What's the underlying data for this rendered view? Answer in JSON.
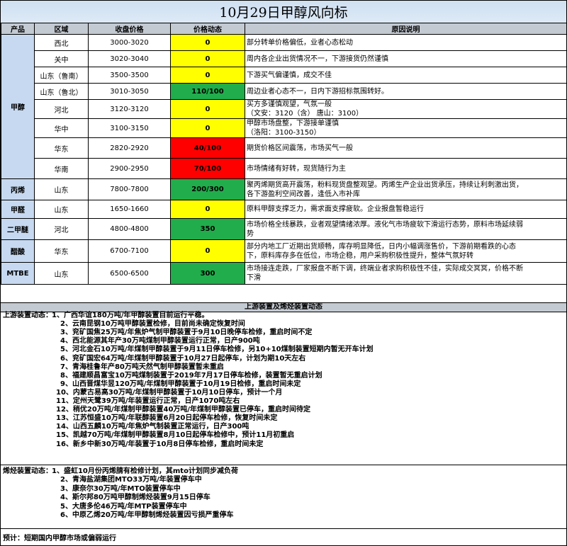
{
  "title": "10月29日甲醇风向标",
  "headers": [
    "产品",
    "区域",
    "收盘价格",
    "价格动态",
    "原因说明"
  ],
  "rows": [
    {
      "product": "甲醇",
      "region": "西北",
      "price": "3000-3020",
      "change": "0",
      "color": "yellow",
      "reason": [
        "部分转单价格偏低，业者心态松动"
      ]
    },
    {
      "product": "",
      "region": "关中",
      "price": "3020-3040",
      "change": "0",
      "color": "yellow",
      "reason": [
        "周内各企业出货情况不一，下游接货仍然谨慎"
      ]
    },
    {
      "product": "",
      "region": "山东（鲁南）",
      "price": "3500-3500",
      "change": "0",
      "color": "yellow",
      "reason": [
        "下游买气偏谨慎，成交不佳"
      ]
    },
    {
      "product": "",
      "region": "山东（鲁北）",
      "price": "3010-3050",
      "change": "110/100",
      "color": "green",
      "reason": [
        "周边业者心态不一，日内下游招标氛围转好。"
      ]
    },
    {
      "product": "",
      "region": "河北",
      "price": "3120-3120",
      "change": "0",
      "color": "yellow",
      "reason": [
        "买方多谨慎观望，气氛一般",
        "（文安：3120（含） 唐山：3100）"
      ]
    },
    {
      "product": "",
      "region": "华中",
      "price": "3100-3150",
      "change": "0",
      "color": "yellow",
      "reason": [
        "甲醇市场盘整，下游接单谨慎",
        "（洛阳：3100-3150）"
      ]
    },
    {
      "product": "",
      "region": "华东",
      "price": "2820-2920",
      "change": "40/100",
      "color": "red",
      "reason": [
        "期货价格区间震荡，市场买气一般"
      ]
    },
    {
      "product": "",
      "region": "华南",
      "price": "2900-2950",
      "change": "70/100",
      "color": "red",
      "reason": [
        "市场情绪有好转，现货随行为主"
      ]
    },
    {
      "product": "丙烯",
      "region": "山东",
      "price": "7800-7800",
      "change": "200/300",
      "color": "green",
      "reason": [
        "聚丙烯期货高开震荡，粉料现货盘整观望。丙烯生产企业出货承压，持续让利刺激出货，",
        "各下游盈利空间改善，逢低入市补库"
      ]
    },
    {
      "product": "甲醛",
      "region": "山东",
      "price": "1650-1660",
      "change": "0",
      "color": "yellow",
      "reason": [
        "原料甲醇支撑乏力，需求面支撑疲软。企业报盘暂稳运行"
      ]
    },
    {
      "product": "二甲醚",
      "region": "河北",
      "price": "4800-4800",
      "change": "350",
      "color": "green",
      "reason": [
        "市场价格全线暴跌，业者观望情绪浓厚。液化气市场疲软下滑运行态势，原料市场延续弱",
        "势"
      ]
    },
    {
      "product": "醋酸",
      "region": "华东",
      "price": "6700-7100",
      "change": "0",
      "color": "yellow",
      "reason": [
        "部分内地工厂近期出货顺畅，库存明显降低，日内小幅调涨售价，下游前期看跌的心态",
        "下，原料库存多在低位，市场企稳，用户采购积极性提升，整体气氛好转"
      ]
    },
    {
      "product": "MTBE",
      "region": "山东",
      "price": "6500-6500",
      "change": "300",
      "color": "green",
      "reason": [
        "市场接连走跌，厂家报盘不断下调，终端业者求购积极性不佳，实际成交冥冥，价格不断",
        "下滑"
      ]
    }
  ],
  "section_title": "上游装置及烯烃装置动态",
  "upstream": {
    "label": "上游装置动态：",
    "items": [
      "1、广西华谊180万吨/年甲醇装置目前运行平稳。",
      "2、云南昆钢10万吨甲醇装置检修，目前尚未确定恢复时间",
      "3、兖矿国焦25万吨/年焦炉气制甲醇装置于9月10日晚停车检修，重启时间不定",
      "4、西北能源其年产30万吨煤制甲醇装置运行正常，日产900吨",
      "5、河北金石10万吨/年煤制甲醇装置于9月11日停车检修，另10+10煤制装置短期内暂无开车计划",
      "6、兖矿国宏64万吨/年煤制甲醇装置于10月27日起停车，计划为期10天左右",
      "7、青海桂鲁年产80万吨天然气制甲醇装置暂未重启",
      "8、福建顺昌富宝10万吨煤制装置于2019年7月17日停车检修，装置暂无重启计划",
      "9、山西晋煤华昱120万吨/年煤制甲醇装置于10月19日检修，重启时间未定",
      "10、内蒙古易高30万吨/年煤制甲醇装置于10月10日停车，预计一个月",
      "11、定州天鹭39万吨/年装置运行正常，日产1070吨左右",
      "12、稍优20万吨/年煤制甲醇装置40万吨/年煤制甲醇装置已停车，重启时间待定",
      "13、江苏恒盛10万吨/年联醇装置6月20日起停车检修，恢复时间未定",
      "14、山西五麟10万吨/年焦炉气制装置正常运行，日产300吨",
      "15、凯越70万吨/年煤制甲醇装置8月10日起停车检修中，预计11月初重启",
      "16、新乡中新30万吨/年装置于10月8日停车检修，重启时间未定"
    ]
  },
  "olefin": {
    "label": "烯烃装置动态：",
    "items": [
      "1、盛虹10月份丙烯腈有检修计划，其mto计划同步减负荷",
      "2、青海盐湖集团MTO33万吨/年装置停车中",
      "3、康奈尔30万吨/年MTO装置停车中",
      "4、斯尔邦80万吨甲醇制烯烃装置9月15日停车",
      "5、大唐多伦46万吨/年MTP装置停车中",
      "6、中原乙烯20万吨/年甲醇制烯烃装置因亏损严重停车"
    ]
  },
  "forecast": "预计：短期国内甲醇市场或偏弱运行",
  "colors": {
    "yellow": "#ffff00",
    "green": "#21ad4c",
    "red": "#ff0000",
    "header": "#c4cad2",
    "product_cell": "#c6d9f0"
  }
}
